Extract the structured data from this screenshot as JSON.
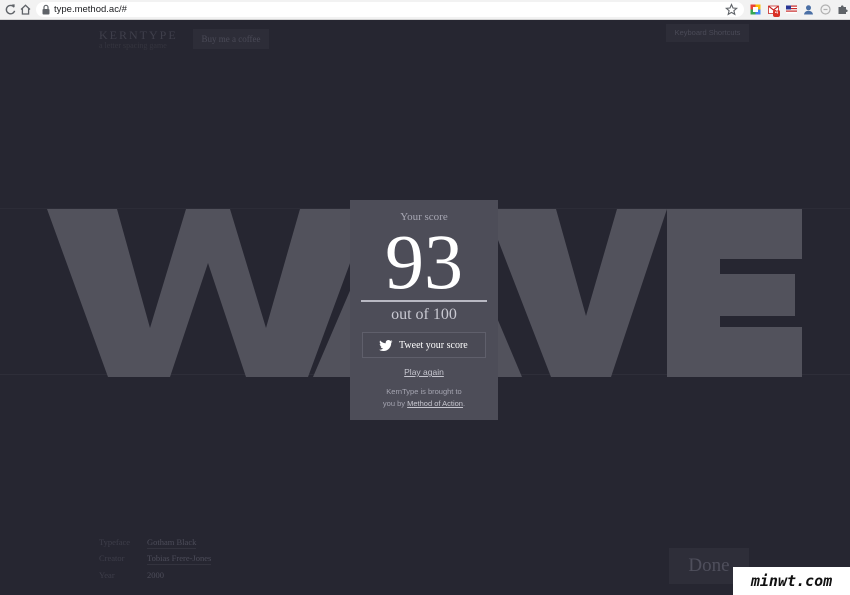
{
  "browser": {
    "url": "type.method.ac/#",
    "gmail_badge": "4"
  },
  "header": {
    "brand": "KERNTYPE",
    "tagline": "a letter spacing game",
    "coffee_button": "Buy me a coffee",
    "shortcuts_button": "Keyboard Shortcuts"
  },
  "word": {
    "letters": [
      "W",
      "A",
      "V",
      "E"
    ]
  },
  "score_card": {
    "label": "Your score",
    "score": "93",
    "total": "out of 100",
    "tweet_button": "Tweet your score",
    "play_again": "Play again",
    "credit_line1": "KernType is brought to",
    "credit_line2_prefix": "you by",
    "credit_link": "Method of Action",
    "credit_suffix": "."
  },
  "meta": {
    "typeface_label": "Typeface",
    "typeface_value": "Gotham Black",
    "creator_label": "Creator",
    "creator_value": "Tobias Frere-Jones",
    "year_label": "Year",
    "year_value": "2000"
  },
  "done_button": "Done",
  "watermark": "minwt.com",
  "colors": {
    "page_background": "#262631",
    "letter_fill": "#52525c",
    "card_background": "#4d4d58"
  }
}
